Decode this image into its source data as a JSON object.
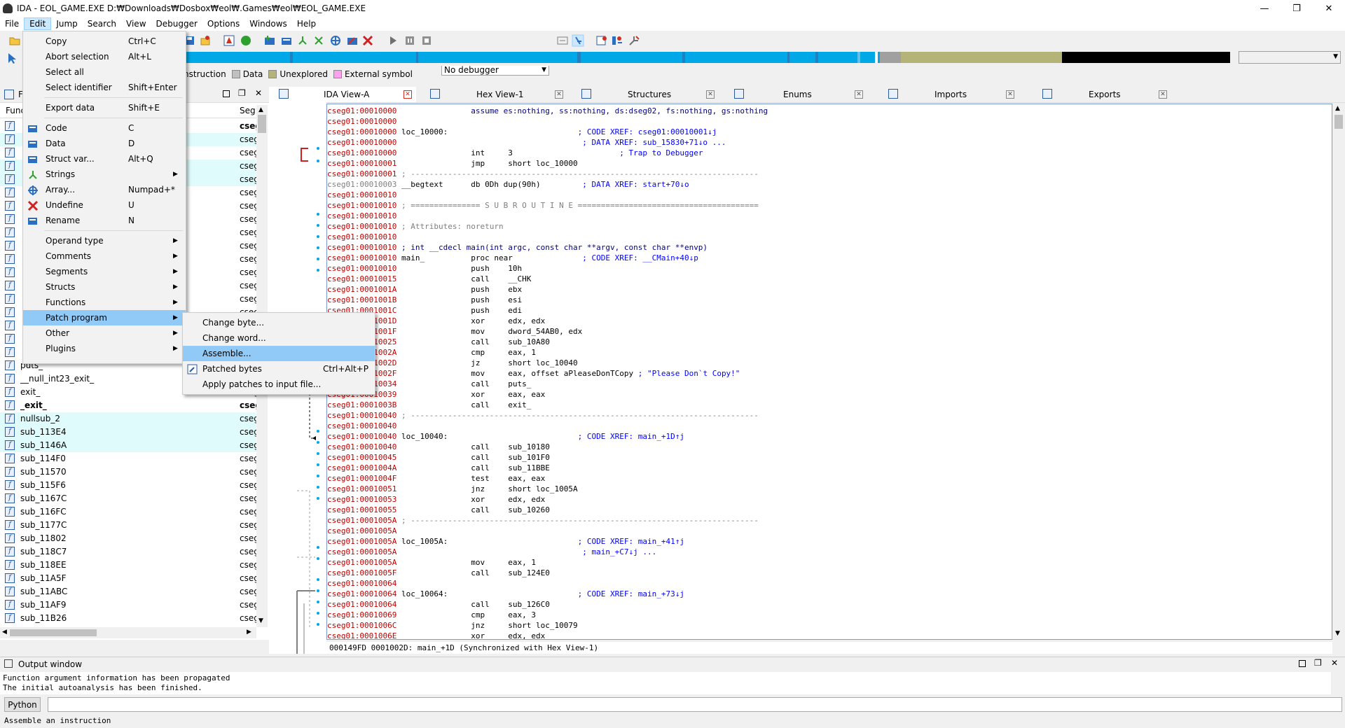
{
  "window": {
    "title": "IDA - EOL_GAME.EXE D:₩Downloads₩Dosbox₩eol₩.Games₩eol₩EOL_GAME.EXE",
    "min": "—",
    "max": "❐",
    "close": "✕"
  },
  "menubar": [
    "File",
    "Edit",
    "Jump",
    "Search",
    "View",
    "Debugger",
    "Options",
    "Windows",
    "Help"
  ],
  "toolbar": {
    "debugger_select": "No debugger"
  },
  "legend": {
    "instruction": "nstruction",
    "data": "Data",
    "unexplored": "Unexplored",
    "external": "External symbol",
    "colors": {
      "data": "#c0c0c0",
      "unexplored": "#b4b478",
      "external": "#ff9ff0"
    }
  },
  "functions_panel": {
    "title": "F",
    "col_name": "Func",
    "col_seg": "Seg",
    "rows": [
      {
        "name": "",
        "seg": "cseg",
        "bold": true
      },
      {
        "name": "",
        "seg": "cseg"
      },
      {
        "name": "",
        "seg": "cseg"
      },
      {
        "name": "",
        "seg": "cseg"
      },
      {
        "name": "",
        "seg": "cseg"
      },
      {
        "name": "",
        "seg": "cseg"
      },
      {
        "name": "",
        "seg": "cseg"
      },
      {
        "name": "",
        "seg": "cseg"
      },
      {
        "name": "",
        "seg": "cseg"
      },
      {
        "name": "",
        "seg": "cseg"
      },
      {
        "name": "",
        "seg": "cseg"
      },
      {
        "name": "",
        "seg": "cseg"
      },
      {
        "name": "",
        "seg": "cseg"
      },
      {
        "name": "",
        "seg": "cseg"
      },
      {
        "name": "",
        "seg": "cseg"
      },
      {
        "name": "",
        "seg": "cseg"
      },
      {
        "name": "",
        "seg": "cseg"
      },
      {
        "name": "",
        "seg": "cseg"
      },
      {
        "name": "puts_",
        "seg": "cseg"
      },
      {
        "name": "__null_int23_exit_",
        "seg": "cseg"
      },
      {
        "name": "exit_",
        "seg": "cseg"
      },
      {
        "name": "_exit_",
        "seg": "cseg",
        "bold": true
      },
      {
        "name": "nullsub_2",
        "seg": "cseg"
      },
      {
        "name": "sub_113E4",
        "seg": "cseg"
      },
      {
        "name": "sub_1146A",
        "seg": "cseg"
      },
      {
        "name": "sub_114F0",
        "seg": "cseg"
      },
      {
        "name": "sub_11570",
        "seg": "cseg"
      },
      {
        "name": "sub_115F6",
        "seg": "cseg"
      },
      {
        "name": "sub_1167C",
        "seg": "cseg"
      },
      {
        "name": "sub_116FC",
        "seg": "cseg"
      },
      {
        "name": "sub_1177C",
        "seg": "cseg"
      },
      {
        "name": "sub_11802",
        "seg": "cseg"
      },
      {
        "name": "sub_118C7",
        "seg": "cseg"
      },
      {
        "name": "sub_118EE",
        "seg": "cseg"
      },
      {
        "name": "sub_11A5F",
        "seg": "cseg"
      },
      {
        "name": "sub_11ABC",
        "seg": "cseg"
      },
      {
        "name": "sub_11AF9",
        "seg": "cseg"
      },
      {
        "name": "sub_11B26",
        "seg": "cseg"
      }
    ]
  },
  "tabs": [
    {
      "label": "IDA View-A",
      "active": true
    },
    {
      "label": "Hex View-1"
    },
    {
      "label": "Structures"
    },
    {
      "label": "Enums"
    },
    {
      "label": "Imports"
    },
    {
      "label": "Exports"
    }
  ],
  "disasm_lines": [
    {
      "a": "cseg01:00010000",
      "t": "                assume es:nothing, ss:nothing, ds:dseg02, fs:nothing, gs:nothing",
      "c": "kw"
    },
    {
      "a": "cseg01:00010000",
      "t": ""
    },
    {
      "a": "cseg01:00010000",
      "t": " loc_10000:",
      "c2": "                            ; CODE XREF: cseg01:00010001↓j"
    },
    {
      "a": "cseg01:00010000",
      "t": "",
      "c2": "                                        ; DATA XREF: sub_15830+71↓o ..."
    },
    {
      "a": "cseg01:00010000",
      "t": "                int     3",
      "c2": "                       ; Trap to Debugger"
    },
    {
      "a": "cseg01:00010001",
      "t": "                jmp     short loc_10000"
    },
    {
      "a": "cseg01:00010001",
      "t": " ; ---------------------------------------------------------------------------",
      "g": true
    },
    {
      "a": "cseg01:00010003",
      "t": " __begtext      db 0Dh dup(90h)",
      "c2": "         ; DATA XREF: start+70↓o",
      "grey": true
    },
    {
      "a": "cseg01:00010010",
      "t": ""
    },
    {
      "a": "cseg01:00010010",
      "t": " ; =============== S U B R O U T I N E =======================================",
      "g": true
    },
    {
      "a": "cseg01:00010010",
      "t": ""
    },
    {
      "a": "cseg01:00010010",
      "t": " ; Attributes: noreturn",
      "g": true
    },
    {
      "a": "cseg01:00010010",
      "t": ""
    },
    {
      "a": "cseg01:00010010",
      "t": " ; int __cdecl main(int argc, const char **argv, const char **envp)",
      "c": "kw"
    },
    {
      "a": "cseg01:00010010",
      "t": " main_          proc near",
      "c2": "               ; CODE XREF: __CMain+40↓p"
    },
    {
      "a": "cseg01:00010010",
      "t": "                push    10h"
    },
    {
      "a": "cseg01:00010015",
      "t": "                call    __CHK"
    },
    {
      "a": "cseg01:0001001A",
      "t": "                push    ebx"
    },
    {
      "a": "cseg01:0001001B",
      "t": "                push    esi"
    },
    {
      "a": "cseg01:0001001C",
      "t": "                push    edi"
    },
    {
      "a": "cseg01:0001001D",
      "t": "                xor     edx, edx"
    },
    {
      "a": "cseg01:0001001F",
      "t": "                mov     dword_54AB0, edx"
    },
    {
      "a": "cseg01:00010025",
      "t": "                call    sub_10A80"
    },
    {
      "a": "cseg01:0001002A",
      "t": "                cmp     eax, 1"
    },
    {
      "a": "cseg01:0001002D",
      "t": "                jz      short loc_10040",
      "hl": true
    },
    {
      "a": "cseg01:0001002F",
      "t": "                mov     eax, offset aPleaseDonTCopy",
      "c2": " ; \"Please Don`t Copy!\""
    },
    {
      "a": "cseg01:00010034",
      "t": "                call    puts_"
    },
    {
      "a": "cseg01:00010039",
      "t": "                xor     eax, eax"
    },
    {
      "a": "cseg01:0001003B",
      "t": "                call    exit_"
    },
    {
      "a": "cseg01:00010040",
      "t": " ; ---------------------------------------------------------------------------",
      "g": true
    },
    {
      "a": "cseg01:00010040",
      "t": ""
    },
    {
      "a": "cseg01:00010040",
      "t": " loc_10040:",
      "c2": "                            ; CODE XREF: main_+1D↑j"
    },
    {
      "a": "cseg01:00010040",
      "t": "                call    sub_10180"
    },
    {
      "a": "cseg01:00010045",
      "t": "                call    sub_101F0"
    },
    {
      "a": "cseg01:0001004A",
      "t": "                call    sub_11BBE"
    },
    {
      "a": "cseg01:0001004F",
      "t": "                test    eax, eax"
    },
    {
      "a": "cseg01:00010051",
      "t": "                jnz     short loc_1005A"
    },
    {
      "a": "cseg01:00010053",
      "t": "                xor     edx, edx"
    },
    {
      "a": "cseg01:00010055",
      "t": "                call    sub_10260"
    },
    {
      "a": "cseg01:0001005A",
      "t": " ; ---------------------------------------------------------------------------",
      "g": true
    },
    {
      "a": "cseg01:0001005A",
      "t": ""
    },
    {
      "a": "cseg01:0001005A",
      "t": " loc_1005A:",
      "c2": "                            ; CODE XREF: main_+41↑j"
    },
    {
      "a": "cseg01:0001005A",
      "t": "",
      "c2": "                                        ; main_+C7↓j ..."
    },
    {
      "a": "cseg01:0001005A",
      "t": "                mov     eax, 1"
    },
    {
      "a": "cseg01:0001005F",
      "t": "                call    sub_124E0"
    },
    {
      "a": "cseg01:00010064",
      "t": ""
    },
    {
      "a": "cseg01:00010064",
      "t": " loc_10064:",
      "c2": "                            ; CODE XREF: main_+73↓j"
    },
    {
      "a": "cseg01:00010064",
      "t": "                call    sub_126C0"
    },
    {
      "a": "cseg01:00010069",
      "t": "                cmp     eax, 3"
    },
    {
      "a": "cseg01:0001006C",
      "t": "                jnz     short loc_10079"
    },
    {
      "a": "cseg01:0001006E",
      "t": "                xor     edx, edx"
    }
  ],
  "disasm_status": "000149FD 0001002D: main_+1D (Synchronized with Hex View-1)",
  "output": {
    "title": "Output window",
    "lines": [
      "Function argument information has been propagated",
      "The initial autoanalysis has been finished."
    ],
    "python_button": "Python"
  },
  "statusbar": "Assemble an instruction",
  "edit_menu": {
    "items": [
      {
        "label": "Copy",
        "shortcut": "Ctrl+C"
      },
      {
        "label": "Abort selection",
        "shortcut": "Alt+L"
      },
      {
        "label": "Select all",
        "shortcut": ""
      },
      {
        "label": "Select identifier",
        "shortcut": "Shift+Enter"
      },
      {
        "sep": true
      },
      {
        "label": "Export data",
        "shortcut": "Shift+E"
      },
      {
        "sep": true
      },
      {
        "label": "Code",
        "shortcut": "C",
        "icon": "code-icon"
      },
      {
        "label": "Data",
        "shortcut": "D",
        "icon": "data-icon"
      },
      {
        "label": "Struct var...",
        "shortcut": "Alt+Q",
        "icon": "struct-var-icon"
      },
      {
        "label": "Strings",
        "sub": true,
        "icon": "strings-icon"
      },
      {
        "label": "Array...",
        "shortcut": "Numpad+*",
        "icon": "array-icon"
      },
      {
        "label": "Undefine",
        "shortcut": "U",
        "icon": "undefine-icon"
      },
      {
        "label": "Rename",
        "shortcut": "N",
        "icon": "rename-icon"
      },
      {
        "sep": true
      },
      {
        "label": "Operand type",
        "sub": true
      },
      {
        "label": "Comments",
        "sub": true
      },
      {
        "label": "Segments",
        "sub": true
      },
      {
        "label": "Structs",
        "sub": true
      },
      {
        "label": "Functions",
        "sub": true
      },
      {
        "label": "Patch program",
        "sub": true,
        "selected": true
      },
      {
        "label": "Other",
        "sub": true
      },
      {
        "label": "Plugins",
        "sub": true
      }
    ]
  },
  "patch_menu": {
    "items": [
      {
        "label": "Change byte...",
        "shortcut": ""
      },
      {
        "label": "Change word...",
        "shortcut": ""
      },
      {
        "label": "Assemble...",
        "shortcut": "",
        "selected": true
      },
      {
        "label": "Patched bytes",
        "shortcut": "Ctrl+Alt+P",
        "icon": "patched-bytes-icon"
      },
      {
        "label": "Apply patches to input file...",
        "shortcut": ""
      }
    ]
  }
}
